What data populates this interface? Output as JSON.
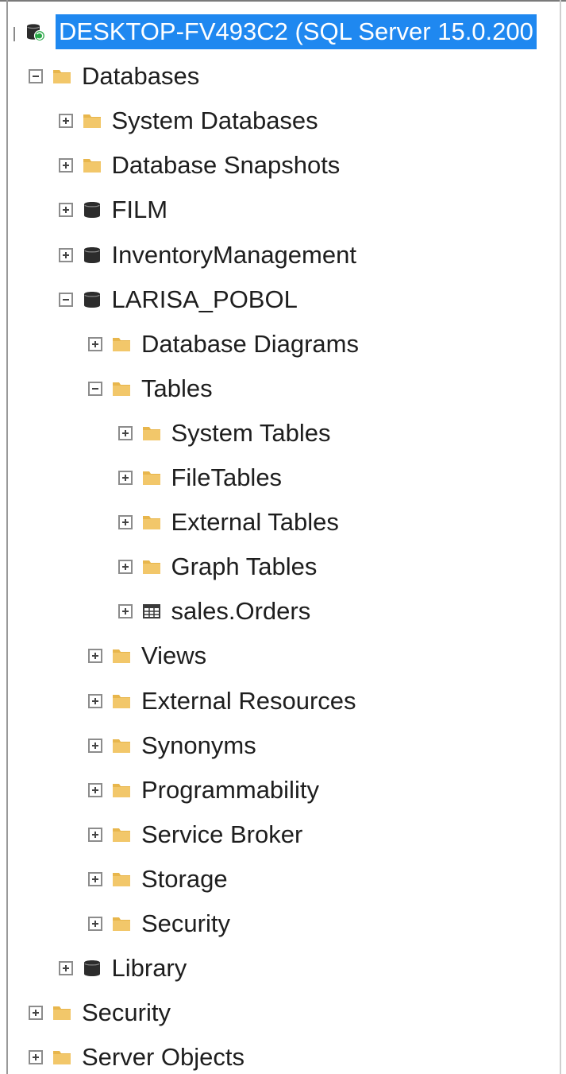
{
  "colors": {
    "selection": "#1f88f0",
    "folder": "#e8b64c",
    "database": "#2c2c2c",
    "connected": "#27a644"
  },
  "tree": [
    {
      "id": "server-root",
      "label": "DESKTOP-FV493C2 (SQL Server 15.0.200",
      "icon": "server-icon",
      "expander": "none",
      "level": 0,
      "selected": true
    },
    {
      "id": "databases",
      "label": "Databases",
      "icon": "folder-icon",
      "expander": "minus",
      "level": 1
    },
    {
      "id": "system-databases",
      "label": "System Databases",
      "icon": "folder-icon",
      "expander": "plus",
      "level": 2
    },
    {
      "id": "database-snapshots",
      "label": "Database Snapshots",
      "icon": "folder-icon",
      "expander": "plus",
      "level": 2
    },
    {
      "id": "db-film",
      "label": "FILM",
      "icon": "database-icon",
      "expander": "plus",
      "level": 2
    },
    {
      "id": "db-inventory",
      "label": "InventoryManagement",
      "icon": "database-icon",
      "expander": "plus",
      "level": 2
    },
    {
      "id": "db-larisa",
      "label": "LARISA_POBOL",
      "icon": "database-icon",
      "expander": "minus",
      "level": 2
    },
    {
      "id": "database-diagrams",
      "label": "Database Diagrams",
      "icon": "folder-icon",
      "expander": "plus",
      "level": 3
    },
    {
      "id": "tables",
      "label": "Tables",
      "icon": "folder-icon",
      "expander": "minus",
      "level": 3
    },
    {
      "id": "system-tables",
      "label": "System Tables",
      "icon": "folder-icon",
      "expander": "plus",
      "level": 4
    },
    {
      "id": "file-tables",
      "label": "FileTables",
      "icon": "folder-icon",
      "expander": "plus",
      "level": 4
    },
    {
      "id": "external-tables",
      "label": "External Tables",
      "icon": "folder-icon",
      "expander": "plus",
      "level": 4
    },
    {
      "id": "graph-tables",
      "label": "Graph Tables",
      "icon": "folder-icon",
      "expander": "plus",
      "level": 4
    },
    {
      "id": "sales-orders",
      "label": "sales.Orders",
      "icon": "table-icon",
      "expander": "plus",
      "level": 4
    },
    {
      "id": "views",
      "label": "Views",
      "icon": "folder-icon",
      "expander": "plus",
      "level": 3
    },
    {
      "id": "external-resources",
      "label": "External Resources",
      "icon": "folder-icon",
      "expander": "plus",
      "level": 3
    },
    {
      "id": "synonyms",
      "label": "Synonyms",
      "icon": "folder-icon",
      "expander": "plus",
      "level": 3
    },
    {
      "id": "programmability",
      "label": "Programmability",
      "icon": "folder-icon",
      "expander": "plus",
      "level": 3
    },
    {
      "id": "service-broker",
      "label": "Service Broker",
      "icon": "folder-icon",
      "expander": "plus",
      "level": 3
    },
    {
      "id": "storage",
      "label": "Storage",
      "icon": "folder-icon",
      "expander": "plus",
      "level": 3
    },
    {
      "id": "db-security",
      "label": "Security",
      "icon": "folder-icon",
      "expander": "plus",
      "level": 3
    },
    {
      "id": "db-library",
      "label": "Library",
      "icon": "database-icon",
      "expander": "plus",
      "level": 2
    },
    {
      "id": "server-security",
      "label": "Security",
      "icon": "folder-icon",
      "expander": "plus",
      "level": 1
    },
    {
      "id": "server-objects",
      "label": "Server Objects",
      "icon": "folder-icon",
      "expander": "plus",
      "level": 1
    }
  ]
}
